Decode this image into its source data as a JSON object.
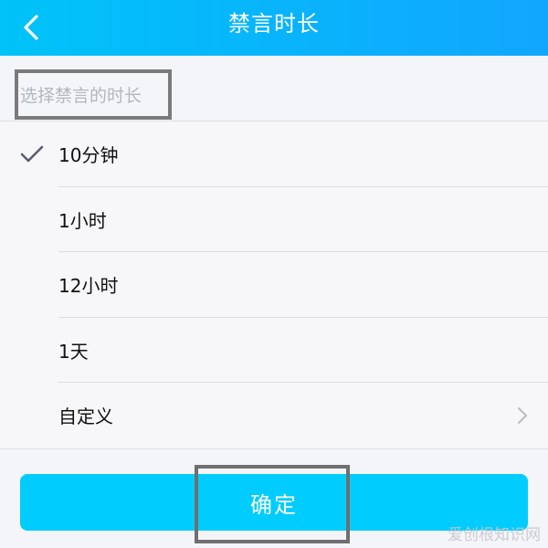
{
  "header": {
    "title": "禁言时长",
    "back_icon": "chevron-left-icon"
  },
  "section": {
    "label": "选择禁言的时长"
  },
  "options": [
    {
      "label": "10分钟",
      "selected": true
    },
    {
      "label": "1小时",
      "selected": false
    },
    {
      "label": "12小时",
      "selected": false
    },
    {
      "label": "1天",
      "selected": false
    },
    {
      "label": "自定义",
      "selected": false,
      "has_chevron": true
    }
  ],
  "footer": {
    "confirm_label": "确定"
  },
  "watermark": "爱创根知识网",
  "colors": {
    "nav_start": "#00c3f8",
    "nav_end": "#11a6ff",
    "confirm": "#00cdfd",
    "check": "#5a5d6e"
  }
}
